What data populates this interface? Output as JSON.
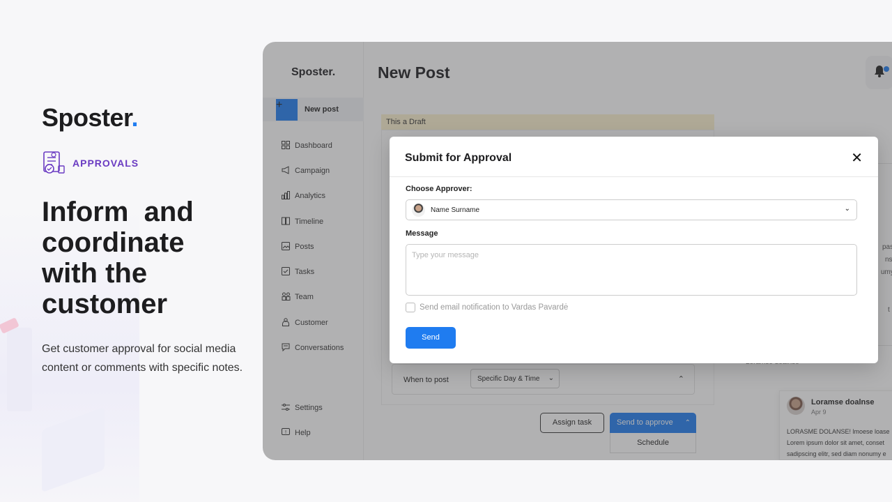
{
  "hero": {
    "brand": "Sposter",
    "brand_dot": ".",
    "tag_label": "APPROVALS",
    "headline_line1": "Inform  and",
    "headline_line2": "coordinate",
    "headline_line3": "with the",
    "headline_line4": "customer",
    "subtext": "Get customer approval for social media content or comments with specific notes."
  },
  "sidebar": {
    "logo": "Sposter.",
    "new_post": "New post",
    "items": [
      {
        "label": "Dashboard",
        "icon": "dashboard-icon"
      },
      {
        "label": "Campaign",
        "icon": "megaphone-icon"
      },
      {
        "label": "Analytics",
        "icon": "bar-chart-icon"
      },
      {
        "label": "Timeline",
        "icon": "timeline-icon"
      },
      {
        "label": "Posts",
        "icon": "image-icon"
      },
      {
        "label": "Tasks",
        "icon": "checklist-icon"
      },
      {
        "label": "Team",
        "icon": "team-icon"
      },
      {
        "label": "Customer",
        "icon": "customer-icon"
      },
      {
        "label": "Conversations",
        "icon": "chat-icon"
      }
    ],
    "bottom": [
      {
        "label": "Settings",
        "icon": "sliders-icon"
      },
      {
        "label": "Help",
        "icon": "help-icon"
      }
    ]
  },
  "main": {
    "title": "New Post",
    "draft_label": "This a Draft",
    "when_label": "When to post",
    "when_value": "Specific Day & Time",
    "assign_task": "Assign task",
    "send_to_approve": "Send to approve",
    "schedule": "Schedule"
  },
  "preview": {
    "peek_line1": "pase",
    "peek_line2": "nse",
    "peek_line3": "umy",
    "peek_line4": "t",
    "peek_footer": "Loramse doalnse",
    "comment_name": "Loramse doalnse",
    "comment_date": "Apr 9",
    "comment_line1": "LORASME DOLANSE! lmoese loase",
    "comment_line2": "Lorem ipsum dolor sit amet, conset",
    "comment_line3": "sadipscing elitr, sed diam nonumy e"
  },
  "modal": {
    "title": "Submit for Approval",
    "close": "✕",
    "approver_label": "Choose Approver:",
    "approver_value": "Name Surname",
    "message_label": "Message",
    "message_placeholder": "Type your message",
    "notify_label": "Send email notification to Vardas Pavardė",
    "send": "Send"
  },
  "colors": {
    "accent": "#1f7cf0",
    "approvals_purple": "#6a3bc2",
    "draft_yellow": "#fbf1cf"
  }
}
